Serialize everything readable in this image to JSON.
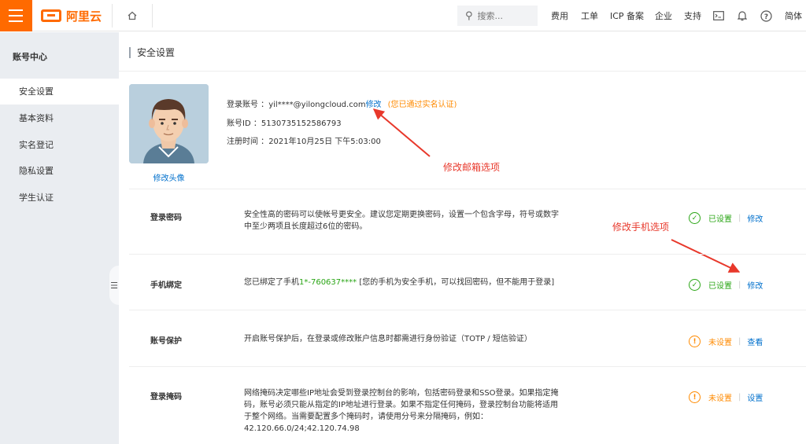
{
  "topbar": {
    "logo_text": "阿里云",
    "search_placeholder": "搜索...",
    "nav": [
      "费用",
      "工单",
      "ICP 备案",
      "企业",
      "支持"
    ],
    "lang": "简体"
  },
  "sidebar": {
    "title": "账号中心",
    "items": [
      "安全设置",
      "基本资料",
      "实名登记",
      "隐私设置",
      "学生认证"
    ]
  },
  "page": {
    "title": "安全设置"
  },
  "profile": {
    "avatar_edit": "修改头像",
    "account_label": "登录账号 ：",
    "account_value": "yil****@yilongcloud.com",
    "account_edit": "修改",
    "verified": "(您已通过实名认证)",
    "id_label": "账号ID ：",
    "id_value": "5130735152586793",
    "reg_label": "注册时间 ：",
    "reg_value": "2021年10月25日 下午5:03:00"
  },
  "annotations": {
    "email": "修改邮箱选项",
    "phone": "修改手机选项"
  },
  "rows": [
    {
      "name": "登录密码",
      "desc_lines": [
        "安全性高的密码可以使帐号更安全。建议您定期更换密码，设置一个包含字母，符号或数字",
        "中至少两项且长度超过6位的密码。"
      ],
      "status": "已设置",
      "action": "修改"
    },
    {
      "name": "手机绑定",
      "desc_prefix": "您已绑定了手机",
      "desc_phone": "1*-760637****",
      "desc_suffix": " [您的手机为安全手机，可以找回密码，但不能用于登录]",
      "status": "已设置",
      "action": "修改"
    },
    {
      "name": "账号保护",
      "desc_lines": [
        "开启账号保护后，在登录或修改账户信息时都需进行身份验证（TOTP / 短信验证）"
      ],
      "status": "未设置",
      "action": "查看"
    },
    {
      "name": "登录掩码",
      "desc_lines": [
        "网络掩码决定哪些IP地址会受到登录控制台的影响，包括密码登录和SSO登录。如果指定掩",
        "码，账号必须只能从指定的IP地址进行登录。如果不指定任何掩码，登录控制台功能将适用",
        "于整个网络。当需要配置多个掩码时，请使用分号来分隔掩码，例如：",
        "42.120.66.0/24;42.120.74.98"
      ],
      "status": "未设置",
      "action": "设置"
    }
  ],
  "colors": {
    "brand": "#ff6a00",
    "link": "#0070cc",
    "ok": "#2aa515",
    "warn": "#ff8a00",
    "annotation": "#e8382b"
  }
}
